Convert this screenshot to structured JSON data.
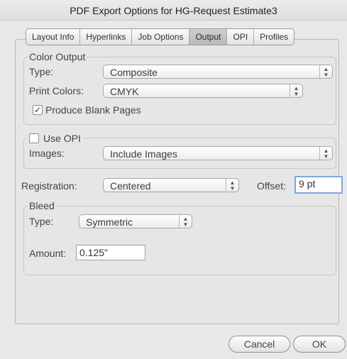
{
  "window": {
    "title": "PDF Export Options for HG-Request Estimate3"
  },
  "tabs": [
    {
      "label": "Layout Info"
    },
    {
      "label": "Hyperlinks"
    },
    {
      "label": "Job Options"
    },
    {
      "label": "Output",
      "active": true
    },
    {
      "label": "OPI"
    },
    {
      "label": "Profiles"
    }
  ],
  "color_output": {
    "legend": "Color Output",
    "type_label": "Type:",
    "type_value": "Composite",
    "print_colors_label": "Print Colors:",
    "print_colors_value": "CMYK",
    "blank_pages_label": "Produce Blank Pages",
    "blank_pages_checked": true
  },
  "opi": {
    "legend": "Use OPI",
    "checked": false,
    "images_label": "Images:",
    "images_value": "Include Images"
  },
  "registration": {
    "label": "Registration:",
    "value": "Centered",
    "offset_label": "Offset:",
    "offset_value": "9 pt"
  },
  "bleed": {
    "legend": "Bleed",
    "type_label": "Type:",
    "type_value": "Symmetric",
    "amount_label": "Amount:",
    "amount_value": "0.125\""
  },
  "buttons": {
    "cancel": "Cancel",
    "ok": "OK"
  },
  "icons": {
    "checkbox_mark": "✓",
    "popup_arrows": "up-down-arrows"
  }
}
